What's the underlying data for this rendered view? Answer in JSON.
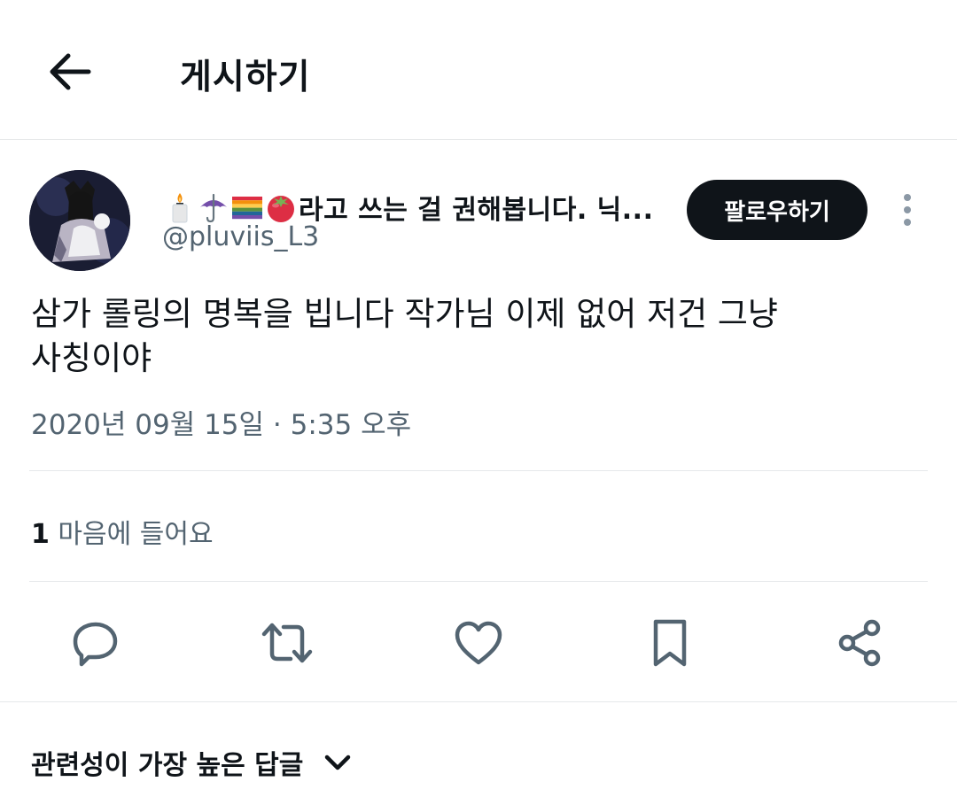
{
  "header": {
    "title": "게시하기"
  },
  "post": {
    "author": {
      "emojis": [
        "candle-emoji",
        "umbrella-emoji",
        "rainbow-flag-emoji",
        "tomato-emoji"
      ],
      "display_name": "라고 쓰는 걸 권해봅니다. 닉...",
      "handle": "@pluviis_L3"
    },
    "follow_label": "팔로우하기",
    "text_line1": "삼가 롤링의 명복을 빕니다 작가님 이제 없어 저건 그냥",
    "text_line2": "사칭이야",
    "timestamp": "2020년 09월 15일 · 5:35 오후",
    "likes": {
      "count": "1",
      "label": "마음에 들어요"
    }
  },
  "actions": [
    "reply-icon",
    "retweet-icon",
    "like-icon",
    "bookmark-icon",
    "share-icon"
  ],
  "replies": {
    "sort_label": "관련성이 가장 높은 답글"
  },
  "colors": {
    "text": "#0f1419",
    "secondary": "#536471",
    "divider": "#e6e8ea",
    "button": "#0f1419"
  }
}
